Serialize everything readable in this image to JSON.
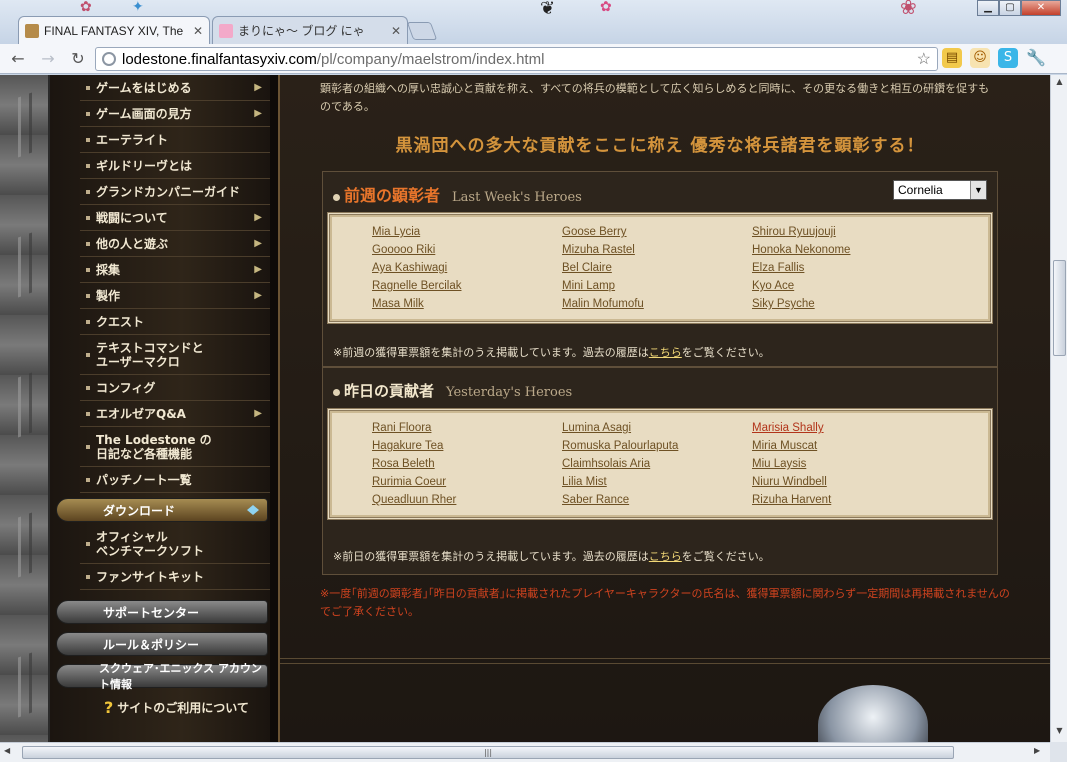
{
  "browser": {
    "tabs": [
      {
        "title": "FINAL FANTASY XIV, The",
        "active": true
      },
      {
        "title": "まりにゃ〜  ブログ   にゃ",
        "active": false
      }
    ],
    "url_host": "lodestone.finalfantasyxiv.com",
    "url_path": "/pl/company/maelstrom/index.html",
    "icons": {
      "back": "back-arrow-icon",
      "forward": "forward-arrow-icon",
      "reload": "reload-icon",
      "bookmark": "star-icon",
      "settings": "wrench-icon"
    }
  },
  "sidebar": {
    "items": [
      {
        "label": "ゲームをはじめる",
        "arrow": true
      },
      {
        "label": "ゲーム画面の見方",
        "arrow": true
      },
      {
        "label": "エーテライト",
        "arrow": false
      },
      {
        "label": "ギルドリーヴとは",
        "arrow": false
      },
      {
        "label": "グランドカンパニーガイド",
        "arrow": false
      },
      {
        "label": "戦闘について",
        "arrow": true
      },
      {
        "label": "他の人と遊ぶ",
        "arrow": true
      },
      {
        "label": "採集",
        "arrow": true
      },
      {
        "label": "製作",
        "arrow": true
      },
      {
        "label": "クエスト",
        "arrow": false
      },
      {
        "label": "テキストコマンドと\nユーザーマクロ",
        "arrow": false,
        "tall": true
      },
      {
        "label": "コンフィグ",
        "arrow": false
      },
      {
        "label": "エオルゼアQ&A",
        "arrow": true
      },
      {
        "label": "The Lodestone の\n日記など各種機能",
        "arrow": false,
        "tall": true
      },
      {
        "label": "パッチノート一覧",
        "arrow": false
      }
    ],
    "download_label": "ダウンロード",
    "download_items": [
      {
        "label": "オフィシャル\nベンチマークソフト",
        "tall": true
      },
      {
        "label": "ファンサイトキット",
        "tall": false
      }
    ],
    "support_label": "サポートセンター",
    "rules_label": "ルール＆ポリシー",
    "account_label": "スクウェア･エニックス アカウント情報",
    "site_terms_label": "サイトのご利用について"
  },
  "content": {
    "intro": "顕彰者の組織への厚い忠誠心と貢献を称え、すべての将兵の模範として広く知らしめると同時に、その更なる働きと相互の研鑽を促すものである。",
    "headline": "黒渦団への多大な貢献をここに称え 優秀な将兵諸君を顕彰する！",
    "last_week": {
      "title_jp": "前週の顕彰者",
      "title_en": "Last Week's Heroes",
      "server": "Cornelia",
      "names": [
        "Mia Lycia",
        "Goose Berry",
        "Shirou Ryuujouji",
        "Gooooo Riki",
        "Mizuha Rastel",
        "Honoka Nekonome",
        "Aya Kashiwagi",
        "Bel Claire",
        "Elza Fallis",
        "Ragnelle Bercilak",
        "Mini Lamp",
        "Kyo Ace",
        "Masa Milk",
        "Malin Mofumofu",
        "Siky Psyche"
      ],
      "note_prefix": "※前週の獲得軍票額を集計のうえ掲載しています。過去の履歴は",
      "note_link": "こちら",
      "note_suffix": "をご覧ください。"
    },
    "yesterday": {
      "title_jp": "昨日の貢献者",
      "title_en": "Yesterday's Heroes",
      "names": [
        "Rani Floora",
        "Lumina Asagi",
        "Marisia Shally",
        "Hagakure Tea",
        "Romuska Palourlaputa",
        "Miria Muscat",
        "Rosa Beleth",
        "Claimhsolais Aria",
        "Miu Laysis",
        "Rurimia Coeur",
        "Lilia Mist",
        "Niuru Windbell",
        "Queadluun Rher",
        "Saber Rance",
        "Rizuha Harvent"
      ],
      "highlighted_name": "Marisia Shally",
      "note_prefix": "※前日の獲得軍票額を集計のうえ掲載しています。過去の履歴は",
      "note_link": "こちら",
      "note_suffix": "をご覧ください。"
    },
    "warning": "※一度｢前週の顕彰者｣｢昨日の貢献者｣に掲載されたプレイヤーキャラクターの氏名は、獲得軍票額に関わらず一定期間は再掲載されませんのでご了承ください。"
  },
  "colors": {
    "accent_orange": "#e8752b",
    "headline_gold": "#d4943c",
    "warning_red": "#d0431f",
    "name_link": "#6e5124"
  }
}
